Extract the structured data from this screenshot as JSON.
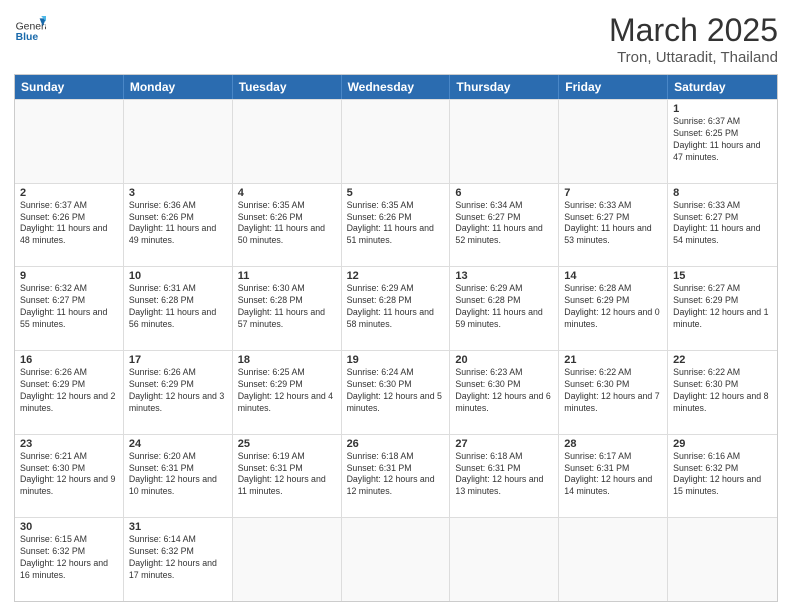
{
  "header": {
    "logo_general": "General",
    "logo_blue": "Blue",
    "month": "March 2025",
    "location": "Tron, Uttaradit, Thailand"
  },
  "weekdays": [
    "Sunday",
    "Monday",
    "Tuesday",
    "Wednesday",
    "Thursday",
    "Friday",
    "Saturday"
  ],
  "rows": [
    [
      {
        "day": "",
        "info": ""
      },
      {
        "day": "",
        "info": ""
      },
      {
        "day": "",
        "info": ""
      },
      {
        "day": "",
        "info": ""
      },
      {
        "day": "",
        "info": ""
      },
      {
        "day": "",
        "info": ""
      },
      {
        "day": "1",
        "info": "Sunrise: 6:37 AM\nSunset: 6:25 PM\nDaylight: 11 hours and 47 minutes."
      }
    ],
    [
      {
        "day": "2",
        "info": "Sunrise: 6:37 AM\nSunset: 6:26 PM\nDaylight: 11 hours and 48 minutes."
      },
      {
        "day": "3",
        "info": "Sunrise: 6:36 AM\nSunset: 6:26 PM\nDaylight: 11 hours and 49 minutes."
      },
      {
        "day": "4",
        "info": "Sunrise: 6:35 AM\nSunset: 6:26 PM\nDaylight: 11 hours and 50 minutes."
      },
      {
        "day": "5",
        "info": "Sunrise: 6:35 AM\nSunset: 6:26 PM\nDaylight: 11 hours and 51 minutes."
      },
      {
        "day": "6",
        "info": "Sunrise: 6:34 AM\nSunset: 6:27 PM\nDaylight: 11 hours and 52 minutes."
      },
      {
        "day": "7",
        "info": "Sunrise: 6:33 AM\nSunset: 6:27 PM\nDaylight: 11 hours and 53 minutes."
      },
      {
        "day": "8",
        "info": "Sunrise: 6:33 AM\nSunset: 6:27 PM\nDaylight: 11 hours and 54 minutes."
      }
    ],
    [
      {
        "day": "9",
        "info": "Sunrise: 6:32 AM\nSunset: 6:27 PM\nDaylight: 11 hours and 55 minutes."
      },
      {
        "day": "10",
        "info": "Sunrise: 6:31 AM\nSunset: 6:28 PM\nDaylight: 11 hours and 56 minutes."
      },
      {
        "day": "11",
        "info": "Sunrise: 6:30 AM\nSunset: 6:28 PM\nDaylight: 11 hours and 57 minutes."
      },
      {
        "day": "12",
        "info": "Sunrise: 6:29 AM\nSunset: 6:28 PM\nDaylight: 11 hours and 58 minutes."
      },
      {
        "day": "13",
        "info": "Sunrise: 6:29 AM\nSunset: 6:28 PM\nDaylight: 11 hours and 59 minutes."
      },
      {
        "day": "14",
        "info": "Sunrise: 6:28 AM\nSunset: 6:29 PM\nDaylight: 12 hours and 0 minutes."
      },
      {
        "day": "15",
        "info": "Sunrise: 6:27 AM\nSunset: 6:29 PM\nDaylight: 12 hours and 1 minute."
      }
    ],
    [
      {
        "day": "16",
        "info": "Sunrise: 6:26 AM\nSunset: 6:29 PM\nDaylight: 12 hours and 2 minutes."
      },
      {
        "day": "17",
        "info": "Sunrise: 6:26 AM\nSunset: 6:29 PM\nDaylight: 12 hours and 3 minutes."
      },
      {
        "day": "18",
        "info": "Sunrise: 6:25 AM\nSunset: 6:29 PM\nDaylight: 12 hours and 4 minutes."
      },
      {
        "day": "19",
        "info": "Sunrise: 6:24 AM\nSunset: 6:30 PM\nDaylight: 12 hours and 5 minutes."
      },
      {
        "day": "20",
        "info": "Sunrise: 6:23 AM\nSunset: 6:30 PM\nDaylight: 12 hours and 6 minutes."
      },
      {
        "day": "21",
        "info": "Sunrise: 6:22 AM\nSunset: 6:30 PM\nDaylight: 12 hours and 7 minutes."
      },
      {
        "day": "22",
        "info": "Sunrise: 6:22 AM\nSunset: 6:30 PM\nDaylight: 12 hours and 8 minutes."
      }
    ],
    [
      {
        "day": "23",
        "info": "Sunrise: 6:21 AM\nSunset: 6:30 PM\nDaylight: 12 hours and 9 minutes."
      },
      {
        "day": "24",
        "info": "Sunrise: 6:20 AM\nSunset: 6:31 PM\nDaylight: 12 hours and 10 minutes."
      },
      {
        "day": "25",
        "info": "Sunrise: 6:19 AM\nSunset: 6:31 PM\nDaylight: 12 hours and 11 minutes."
      },
      {
        "day": "26",
        "info": "Sunrise: 6:18 AM\nSunset: 6:31 PM\nDaylight: 12 hours and 12 minutes."
      },
      {
        "day": "27",
        "info": "Sunrise: 6:18 AM\nSunset: 6:31 PM\nDaylight: 12 hours and 13 minutes."
      },
      {
        "day": "28",
        "info": "Sunrise: 6:17 AM\nSunset: 6:31 PM\nDaylight: 12 hours and 14 minutes."
      },
      {
        "day": "29",
        "info": "Sunrise: 6:16 AM\nSunset: 6:32 PM\nDaylight: 12 hours and 15 minutes."
      }
    ],
    [
      {
        "day": "30",
        "info": "Sunrise: 6:15 AM\nSunset: 6:32 PM\nDaylight: 12 hours and 16 minutes."
      },
      {
        "day": "31",
        "info": "Sunrise: 6:14 AM\nSunset: 6:32 PM\nDaylight: 12 hours and 17 minutes."
      },
      {
        "day": "",
        "info": ""
      },
      {
        "day": "",
        "info": ""
      },
      {
        "day": "",
        "info": ""
      },
      {
        "day": "",
        "info": ""
      },
      {
        "day": "",
        "info": ""
      }
    ]
  ]
}
